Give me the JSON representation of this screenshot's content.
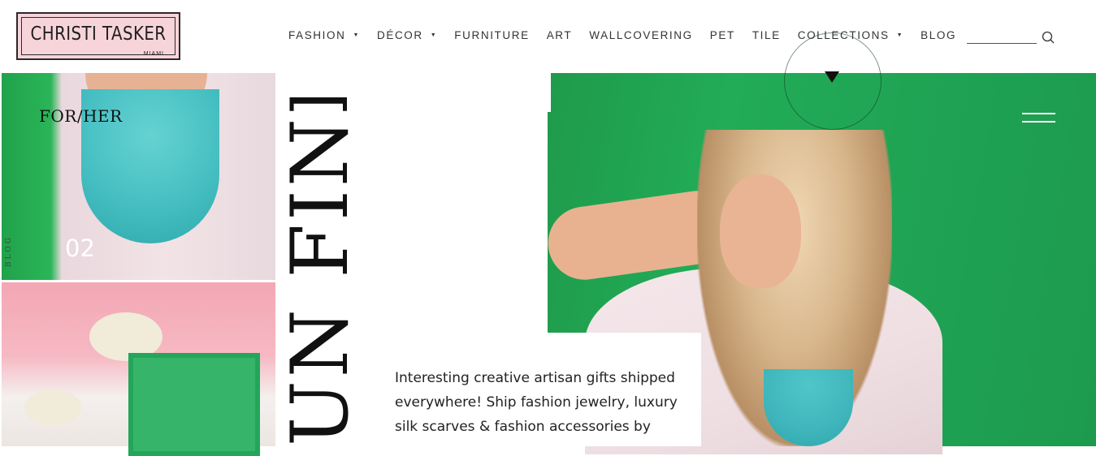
{
  "header": {
    "logo_text": "CHRISTI TASKER",
    "logo_sub": "MIAMI",
    "nav": [
      {
        "label": "FASHION",
        "dropdown": true
      },
      {
        "label": "DÉCOR",
        "dropdown": true
      },
      {
        "label": "FURNITURE",
        "dropdown": false
      },
      {
        "label": "ART",
        "dropdown": false
      },
      {
        "label": "WALLCOVERING",
        "dropdown": false
      },
      {
        "label": "PET",
        "dropdown": false
      },
      {
        "label": "TILE",
        "dropdown": false
      },
      {
        "label": "COLLECTIONS",
        "dropdown": true
      },
      {
        "label": "BLOG",
        "dropdown": false
      }
    ],
    "search_icon": "search-icon"
  },
  "left": {
    "label": "FOR/HER",
    "number": "02",
    "blog_label": "BLOG"
  },
  "headline": "UN FINDS",
  "card": {
    "text": "Interesting creative artisan gifts shipped everywhere! Ship fashion jewelry, luxury silk scarves & fashion accessories by"
  },
  "colors": {
    "accent_green": "#22ac57",
    "logo_pink": "#f7d4da",
    "text_dark": "#222222"
  }
}
